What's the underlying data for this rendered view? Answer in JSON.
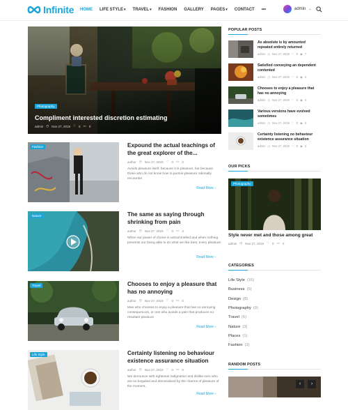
{
  "header": {
    "logo_text": "Infinite",
    "nav": [
      {
        "label": "HOME",
        "active": true,
        "caret": false
      },
      {
        "label": "LIFE STYLE",
        "active": false,
        "caret": true
      },
      {
        "label": "TRAVEL",
        "active": false,
        "caret": true
      },
      {
        "label": "FASHION",
        "active": false,
        "caret": false
      },
      {
        "label": "GALLERY",
        "active": false,
        "caret": false
      },
      {
        "label": "PAGES",
        "active": false,
        "caret": true
      },
      {
        "label": "CONTACT",
        "active": false,
        "caret": false
      },
      {
        "label": "•••",
        "active": false,
        "caret": false
      }
    ],
    "user_name": "admin",
    "accent": "#1ba5d8"
  },
  "featured": {
    "badge": "Photography",
    "title": "Compliment interested discretion estimating",
    "author": "admin",
    "date": "Nov 27, 2019",
    "likes": "0",
    "comments": "0"
  },
  "posts": [
    {
      "badge": "Fashion",
      "title": "Expound the actual teachings of the great explorer of the...",
      "author": "author",
      "date": "Nov 27, 2019",
      "likes": "0",
      "comments": "0",
      "excerpt": "Avoids pleasure itself, because it is pleasure, but because those who do not know how to pursue pleasure rationally encounter",
      "read_more": "Read More"
    },
    {
      "badge": "Nature",
      "title": "The same as saying through shrinking from pain",
      "author": "author",
      "date": "Nov 27, 2019",
      "likes": "0",
      "comments": "3",
      "excerpt": "When our power of choice is untrammelled and when nothing prevents our being able to do what we like best, every pleasure",
      "read_more": "Read More"
    },
    {
      "badge": "Travel",
      "title": "Chooses to enjoy a pleasure that has no annoying",
      "author": "author",
      "date": "Nov 27, 2019",
      "likes": "0",
      "comments": "0",
      "excerpt": "Man who chooses to enjoy a pleasure that has no annoying consequences, or one who avoids a pain that produces no resultant pleasure",
      "read_more": "Read More"
    },
    {
      "badge": "Life Style",
      "title": "Certainty listening no behaviour existence assurance situation",
      "author": "author",
      "date": "Nov 27, 2019",
      "likes": "0",
      "comments": "0",
      "excerpt": "We denounce with righteous indignation and dislike men who are so beguiled and demoralized by the charms of pleasure of the moment,",
      "read_more": "Read More"
    }
  ],
  "sidebar": {
    "popular_heading": "POPULAR POSTS",
    "popular": [
      {
        "title": "As absolute is by amounted repeated entirely returned",
        "author": "admin",
        "date": "Nov 27, 2019",
        "likes": "0",
        "views": "7"
      },
      {
        "title": "Satisfied conveying an dependent contented",
        "author": "admin",
        "date": "Nov 27, 2019",
        "likes": "0",
        "views": "4"
      },
      {
        "title": "Chooses to enjoy a pleasure that has no annoying",
        "author": "admin",
        "date": "Nov 27, 2019",
        "likes": "0",
        "views": "4"
      },
      {
        "title": "Various versions have evolved sometimes",
        "author": "admin",
        "date": "Nov 27, 2019",
        "likes": "0",
        "views": "3"
      },
      {
        "title": "Certainty listening no behaviour existence assurance situation",
        "author": "admin",
        "date": "Nov 27, 2019",
        "likes": "0",
        "views": "3"
      }
    ],
    "picks_heading": "OUR PICKS",
    "pick": {
      "badge": "Photography",
      "title": "Style never met and those among great",
      "author": "admin",
      "date": "Nov 27, 2019",
      "likes": "0",
      "comments": "0"
    },
    "categories_heading": "CATEGORIES",
    "categories": [
      {
        "name": "Life Style",
        "count": "(16)"
      },
      {
        "name": "Business",
        "count": "(5)"
      },
      {
        "name": "Design",
        "count": "(8)"
      },
      {
        "name": "Photography",
        "count": "(9)"
      },
      {
        "name": "Travel",
        "count": "(6)"
      },
      {
        "name": "Nature",
        "count": "(3)"
      },
      {
        "name": "Places",
        "count": "(1)"
      },
      {
        "name": "Fashion",
        "count": "(3)"
      }
    ],
    "random_heading": "RANDOM POSTS",
    "prev_arrow": "‹",
    "next_arrow": "›"
  }
}
